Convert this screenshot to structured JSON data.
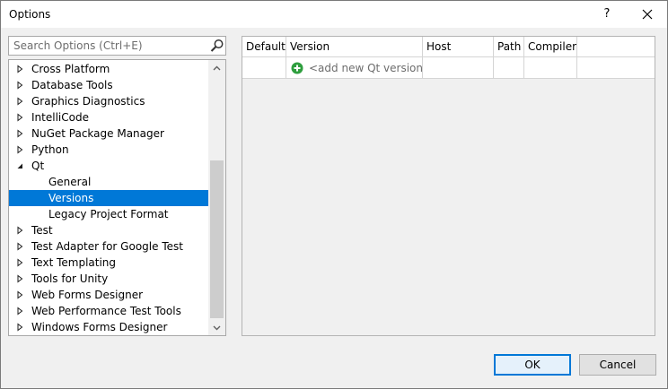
{
  "window": {
    "title": "Options",
    "help_label": "?"
  },
  "search": {
    "placeholder": "Search Options (Ctrl+E)"
  },
  "tree": {
    "items": [
      {
        "label": "Cross Platform",
        "level": 0,
        "state": "collapsed"
      },
      {
        "label": "Database Tools",
        "level": 0,
        "state": "collapsed"
      },
      {
        "label": "Graphics Diagnostics",
        "level": 0,
        "state": "collapsed"
      },
      {
        "label": "IntelliCode",
        "level": 0,
        "state": "collapsed"
      },
      {
        "label": "NuGet Package Manager",
        "level": 0,
        "state": "collapsed"
      },
      {
        "label": "Python",
        "level": 0,
        "state": "collapsed"
      },
      {
        "label": "Qt",
        "level": 0,
        "state": "expanded"
      },
      {
        "label": "General",
        "level": 1,
        "state": "leaf"
      },
      {
        "label": "Versions",
        "level": 1,
        "state": "leaf",
        "selected": true
      },
      {
        "label": "Legacy Project Format",
        "level": 1,
        "state": "leaf"
      },
      {
        "label": "Test",
        "level": 0,
        "state": "collapsed"
      },
      {
        "label": "Test Adapter for Google Test",
        "level": 0,
        "state": "collapsed"
      },
      {
        "label": "Text Templating",
        "level": 0,
        "state": "collapsed"
      },
      {
        "label": "Tools for Unity",
        "level": 0,
        "state": "collapsed"
      },
      {
        "label": "Web Forms Designer",
        "level": 0,
        "state": "collapsed"
      },
      {
        "label": "Web Performance Test Tools",
        "level": 0,
        "state": "collapsed"
      },
      {
        "label": "Windows Forms Designer",
        "level": 0,
        "state": "collapsed"
      }
    ]
  },
  "versions_grid": {
    "columns": [
      "Default",
      "Version",
      "Host",
      "Path",
      "Compiler",
      ""
    ],
    "add_row_label": "<add new Qt version>"
  },
  "buttons": {
    "ok": "OK",
    "cancel": "Cancel"
  },
  "colors": {
    "selection": "#0078d7",
    "add_icon": "#2e9e3e"
  },
  "icons": {
    "search": "search-icon",
    "close": "close-icon",
    "add": "plus-circle-icon"
  }
}
